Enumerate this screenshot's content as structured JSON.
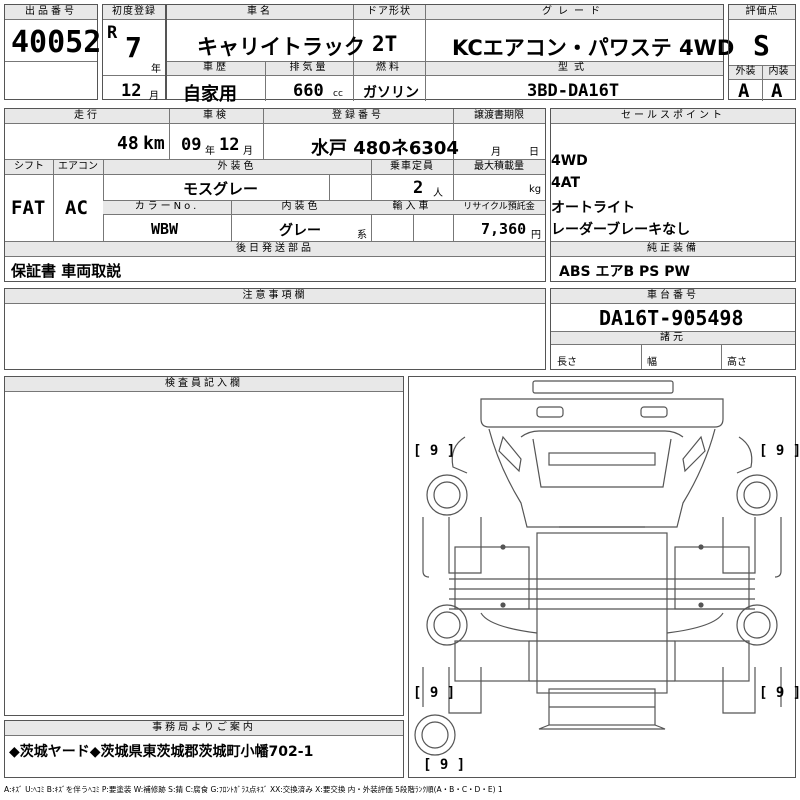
{
  "header": {
    "lot_no_label": "出品番号",
    "lot_no": "40052",
    "first_reg_label": "初度登録",
    "era": "R",
    "year": "7",
    "year_unit": "年",
    "month": "12",
    "month_unit": "月",
    "car_name_label": "車名",
    "car_name": "キャリイトラック",
    "door_label": "ドア形状",
    "door": "2T",
    "grade_label": "グレード",
    "grade": "KCエアコン・パワステ 4WD",
    "score_label": "評価点",
    "score": "S",
    "history_label": "車歴",
    "history": "自家用",
    "displacement_label": "排気量",
    "displacement": "660",
    "displacement_unit": "cc",
    "fuel_label": "燃料",
    "fuel": "ガソリン",
    "model_label": "型式",
    "model": "3BD-DA16T",
    "exterior_label": "外装",
    "exterior": "A",
    "interior_label": "内装",
    "interior": "A"
  },
  "row2": {
    "mileage_label": "走行",
    "mileage": "48",
    "mileage_unit": "km",
    "inspection_label": "車検",
    "insp_year": "09",
    "insp_year_unit": "年",
    "insp_month": "12",
    "insp_month_unit": "月",
    "reg_no_label": "登録番号",
    "reg_no": "水戸 480ネ6304",
    "transfer_label": "譲渡書期限",
    "transfer_month": "月",
    "transfer_day": "日",
    "shift_label": "シフト",
    "shift": "FAT",
    "ac_label": "エアコン",
    "ac": "AC",
    "ext_color_label": "外装色",
    "ext_color": "モスグレー",
    "capacity_label": "乗車定員",
    "capacity": "2",
    "capacity_unit": "人",
    "load_label": "最大積載量",
    "load_unit": "kg",
    "color_no_label": "カラーNo.",
    "color_no": "WBW",
    "int_color_label": "内装色",
    "int_color": "グレー",
    "int_color_unit": "系",
    "import_label": "輸入車",
    "recycle_label": "リサイクル預託金",
    "recycle": "7,360",
    "recycle_unit": "円",
    "later_label": "後日発送部品",
    "later": "保証書 車両取説"
  },
  "sales": {
    "label": "セールスポイント",
    "points": [
      "4WD",
      "4AT",
      "オートライト",
      "レーダーブレーキなし"
    ],
    "equip_label": "純正装備",
    "equip": "ABS エアB PS PW"
  },
  "notes": {
    "label": "注意事項欄"
  },
  "chassis": {
    "label": "車台番号",
    "number": "DA16T-905498",
    "specs_label": "諸元",
    "length_label": "長さ",
    "width_label": "幅",
    "height_label": "高さ"
  },
  "inspector": {
    "label": "検査員記入欄"
  },
  "diagram": {
    "tire_fl": "[ 9 ]",
    "tire_fr": "[ 9 ]",
    "tire_rl": "[ 9 ]",
    "tire_rr": "[ 9 ]",
    "tire_spare": "[ 9 ]"
  },
  "office": {
    "label": "事務局よりご案内",
    "text": "◆茨城ヤード◆茨城県東茨城郡茨城町小幡702-1"
  },
  "legend": "A:ｷｽﾞ U:ﾍｺﾐ B:ｷｽﾞを伴うﾍｺﾐ P:要塗装 W:補修跡 S:錆 C:腐食 G:ﾌﾛﾝﾄｶﾞﾗｽ点ｷｽﾞ XX:交換済み X:要交換 内・外装評価 5段階ﾗﾝｸ順(A・B・C・D・E) 1"
}
